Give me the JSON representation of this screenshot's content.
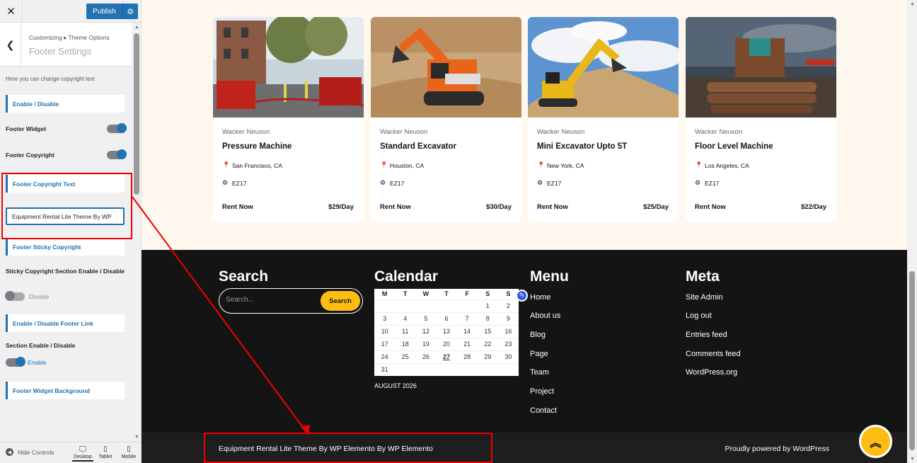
{
  "customizer": {
    "close_icon": "close-icon",
    "publish_label": "Publish",
    "breadcrumb": "Customizing ▸ Theme Options",
    "section_title": "Footer Settings",
    "description": "Here you can change copyright text",
    "enable_disable_heading": "Enable / Disable",
    "footer_widget_label": "Footer Widget",
    "footer_copyright_label": "Footer Copyright",
    "copyright_text_heading": "Footer Copyright Text",
    "copyright_text_value": "Equipment Rental Lite Theme By WP",
    "sticky_copyright_heading": "Footer Sticky Copyright",
    "sticky_section_label": "Sticky Copyright Section Enable / Disable",
    "sticky_toggle_state": "Disable",
    "footer_link_heading": "Enable / Disable Footer Link",
    "section_enable_label": "Section Enable / Disable",
    "section_toggle_state": "Enable",
    "widget_bg_heading": "Footer Widget Background",
    "hide_controls": "Hide Controls",
    "devices": {
      "desktop": "Desktop",
      "tablet": "Tablet",
      "mobile": "Mobile"
    }
  },
  "products": [
    {
      "brand": "Wacker Neuson",
      "title": "Pressure Machine",
      "location": "San Francisco, CA",
      "code": "EZ17",
      "rent": "Rent Now",
      "price": "$29/Day"
    },
    {
      "brand": "Wacker Neuson",
      "title": "Standard Excavator",
      "location": "Houston, CA",
      "code": "EZ17",
      "rent": "Rent Now",
      "price": "$30/Day"
    },
    {
      "brand": "Wacker Neuson",
      "title": "Mini Excavator Upto 5T",
      "location": "New York, CA",
      "code": "EZ17",
      "rent": "Rent Now",
      "price": "$25/Day"
    },
    {
      "brand": "Wacker Neuson",
      "title": "Floor Level Machine",
      "location": "Los Angeles, CA",
      "code": "EZ17",
      "rent": "Rent Now",
      "price": "$22/Day"
    }
  ],
  "footer": {
    "search_title": "Search",
    "search_placeholder": "Search...",
    "search_button": "Search",
    "calendar_title": "Calendar",
    "calendar_days": [
      "M",
      "T",
      "W",
      "T",
      "F",
      "S",
      "S"
    ],
    "calendar_weeks": [
      [
        "",
        "",
        "",
        "",
        "",
        "1",
        "2"
      ],
      [
        "3",
        "4",
        "5",
        "6",
        "7",
        "8",
        "9"
      ],
      [
        "10",
        "11",
        "12",
        "13",
        "14",
        "15",
        "16"
      ],
      [
        "17",
        "18",
        "19",
        "20",
        "21",
        "22",
        "23"
      ],
      [
        "24",
        "25",
        "26",
        "27",
        "28",
        "29",
        "30"
      ],
      [
        "31",
        "",
        "",
        "",
        "",
        "",
        ""
      ]
    ],
    "calendar_caption": "AUGUST 2026",
    "menu_title": "Menu",
    "menu_items": [
      "Home",
      "About us",
      "Blog",
      "Page",
      "Team",
      "Project",
      "Contact"
    ],
    "meta_title": "Meta",
    "meta_items": [
      "Site Admin",
      "Log out",
      "Entries feed",
      "Comments feed",
      "WordPress.org"
    ],
    "copyright": "Equipment Rental Lite Theme By WP Elemento By WP Elemento",
    "powered": "Proudly powered by WordPress"
  },
  "colors": {
    "accent": "#2271b1",
    "yellow": "#ffbd13",
    "footer_bg": "#141414",
    "annotation": "#e00000"
  }
}
